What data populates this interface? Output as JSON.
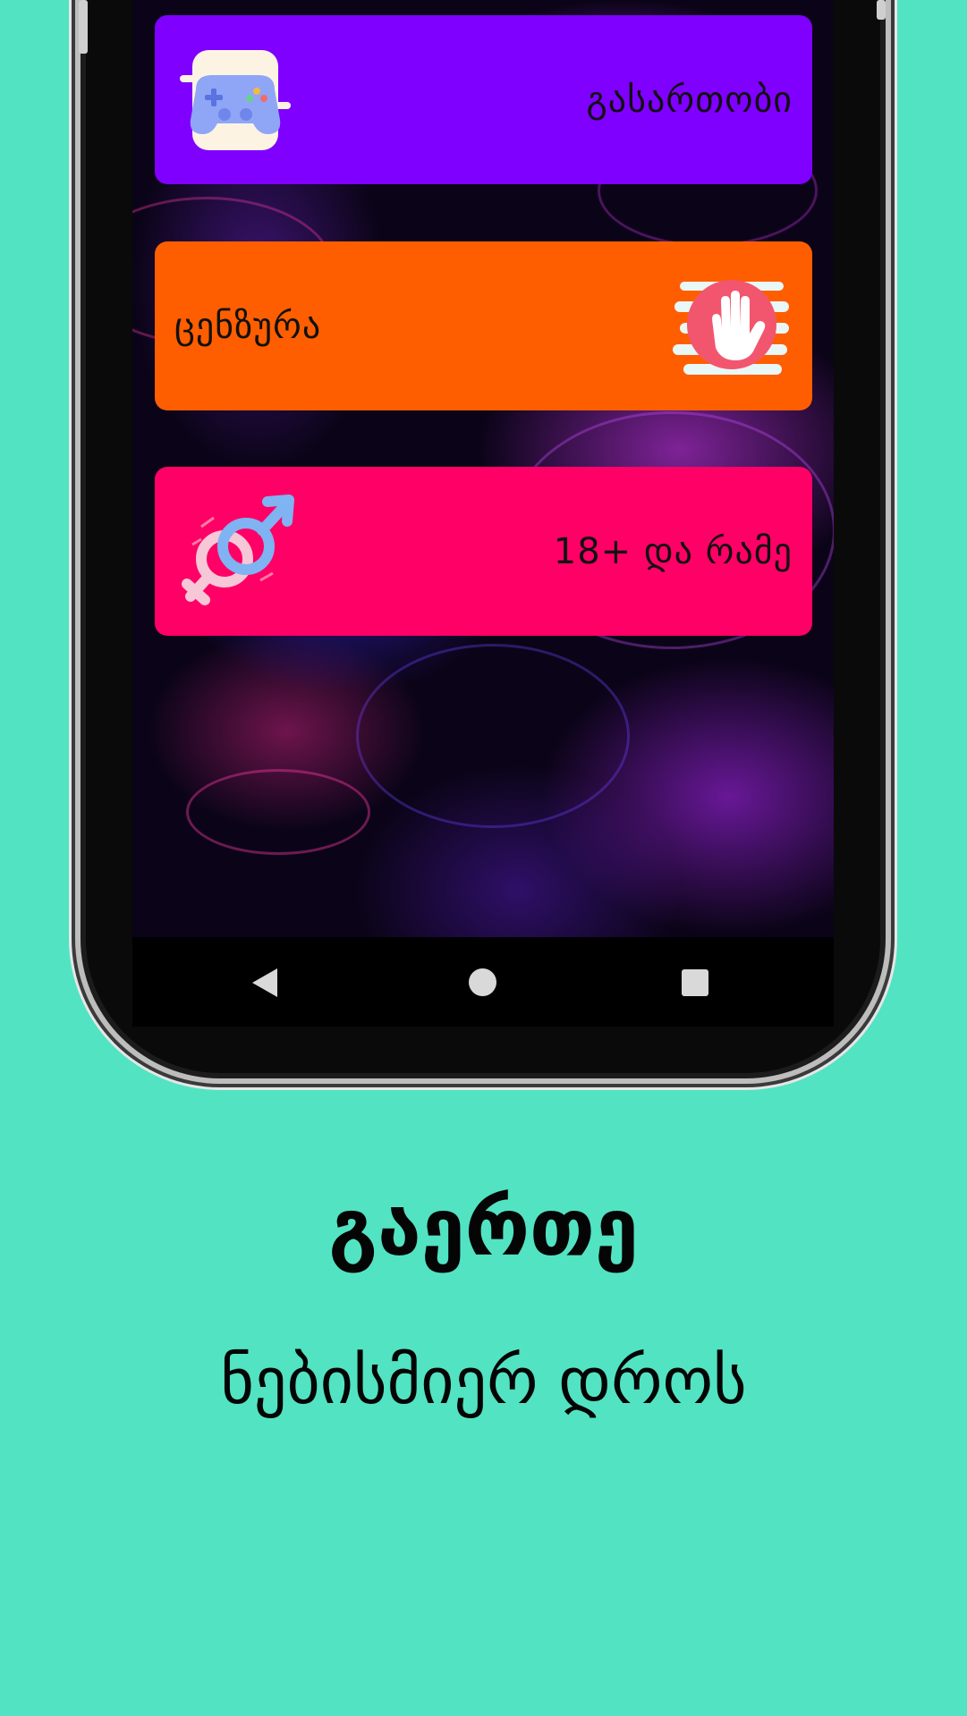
{
  "colors": {
    "background": "#52e3c2",
    "games_card": "#7f00ff",
    "censor_card": "#ff5e00",
    "adult_card": "#ff0066"
  },
  "menu": {
    "items": [
      {
        "label": "გასართობი",
        "icon": "gamepad-icon"
      },
      {
        "label": "ცენზურა",
        "icon": "stop-hand-icon"
      },
      {
        "label": "18+ და რამე",
        "icon": "gender-symbols-icon"
      }
    ]
  },
  "nav": {
    "back_icon": "back-triangle-icon",
    "home_icon": "home-circle-icon",
    "recent_icon": "recent-apps-square-icon"
  },
  "promo": {
    "headline": "გაერთე",
    "subline": "ნებისმიერ დროს"
  }
}
